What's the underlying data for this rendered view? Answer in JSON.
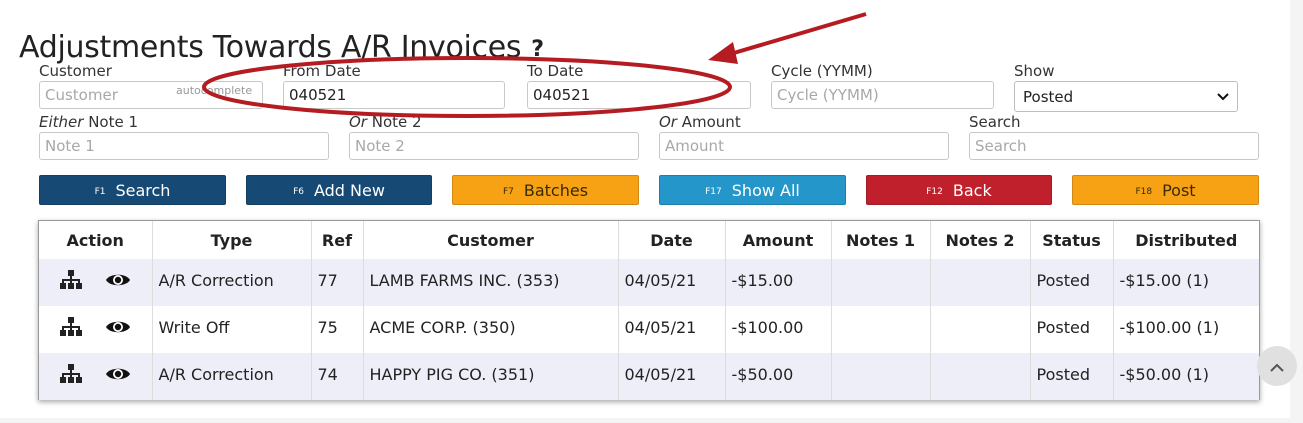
{
  "page": {
    "title": "Adjustments Towards A/R Invoices",
    "help": "?"
  },
  "filters": {
    "customer": {
      "label": "Customer",
      "placeholder": "Customer",
      "value": "",
      "hint": "autocomplete"
    },
    "from_date": {
      "label": "From Date",
      "value": "040521"
    },
    "to_date": {
      "label": "To Date",
      "value": "040521"
    },
    "cycle": {
      "label": "Cycle (YYMM)",
      "placeholder": "Cycle (YYMM)",
      "value": ""
    },
    "show": {
      "label": "Show",
      "selected": "Posted"
    },
    "note1": {
      "label_prefix": "Either",
      "label": " Note 1",
      "placeholder": "Note 1"
    },
    "note2": {
      "label_prefix": "Or",
      "label": " Note 2",
      "placeholder": "Note 2"
    },
    "amount": {
      "label_prefix": "Or",
      "label": " Amount",
      "placeholder": "Amount"
    },
    "search": {
      "label": "Search",
      "placeholder": "Search"
    }
  },
  "buttons": {
    "search": {
      "key": "F1",
      "label": "Search"
    },
    "add_new": {
      "key": "F6",
      "label": "Add New"
    },
    "batches": {
      "key": "F7",
      "label": "Batches"
    },
    "show_all": {
      "key": "F17",
      "label": "Show All"
    },
    "back": {
      "key": "F12",
      "label": "Back"
    },
    "post": {
      "key": "F18",
      "label": "Post"
    }
  },
  "table": {
    "headers": [
      "Action",
      "Type",
      "Ref",
      "Customer",
      "Date",
      "Amount",
      "Notes 1",
      "Notes 2",
      "Status",
      "Distributed"
    ],
    "rows": [
      {
        "type": "A/R Correction",
        "ref": "77",
        "customer": "LAMB FARMS INC. (353)",
        "date": "04/05/21",
        "amount": "-$15.00",
        "notes1": "",
        "notes2": "",
        "status": "Posted",
        "distributed": "-$15.00 (1)"
      },
      {
        "type": "Write Off",
        "ref": "75",
        "customer": "ACME CORP. (350)",
        "date": "04/05/21",
        "amount": "-$100.00",
        "notes1": "",
        "notes2": "",
        "status": "Posted",
        "distributed": "-$100.00 (1)"
      },
      {
        "type": "A/R Correction",
        "ref": "74",
        "customer": "HAPPY PIG CO. (351)",
        "date": "04/05/21",
        "amount": "-$50.00",
        "notes1": "",
        "notes2": "",
        "status": "Posted",
        "distributed": "-$50.00 (1)"
      }
    ]
  },
  "icons": {
    "hierarchy": "sitemap-icon",
    "view": "eye-icon",
    "scroll": "chevron-up-icon"
  },
  "colors": {
    "primary_button": "#164a75",
    "orange_button": "#f7a114",
    "teal_button": "#2496c9",
    "red_button": "#c0202c",
    "annotation": "#b51c22",
    "row_shade": "#eeeef9"
  }
}
